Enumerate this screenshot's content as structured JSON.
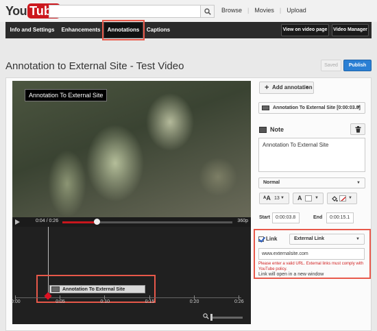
{
  "header": {
    "logo_you": "You",
    "logo_tube": "Tube",
    "search_placeholder": "",
    "links": [
      "Browse",
      "Movies",
      "Upload"
    ]
  },
  "nav": {
    "tabs": [
      "Info and Settings",
      "Enhancements",
      "Annotations",
      "Captions"
    ],
    "active_tab": "Annotations",
    "view_on_video_page": "View on video page",
    "video_manager": "Video Manager"
  },
  "page": {
    "title": "Annotation to External Site - Test Video",
    "saved_label": "Saved",
    "publish_label": "Publish"
  },
  "player": {
    "annotation_overlay": "Annotation To External Site",
    "time": "0:04 / 0:26",
    "quality": "360p",
    "progress": 0.2
  },
  "timeline": {
    "annotation_label": "Annotation To External Site",
    "ticks": [
      "0:00",
      "0:05",
      "0:10",
      "0:15",
      "0:20",
      "0:26"
    ]
  },
  "panel": {
    "add_annotation": "Add annotation",
    "selected_annotation": "Annotation To External Site [0:00:03.8]",
    "note_label": "Note",
    "note_text": "Annotation To External Site",
    "font_style": "Normal",
    "font_size": "13",
    "start_label": "Start",
    "start_value": "0:00:03.8",
    "end_label": "End",
    "end_value": "0:00:15.1",
    "link_label": "Link",
    "link_checked": true,
    "link_type": "External Link",
    "url_value": "www.externalsite.com",
    "error_text": "Please enter a valid URL. External links must comply with YouTube policy.",
    "open_text": "Link will open in a new window"
  },
  "colors": {
    "accent_red": "#cc181e",
    "highlight": "#e8584a",
    "publish_blue": "#2a7fd4",
    "error_red": "#d01c1c"
  }
}
